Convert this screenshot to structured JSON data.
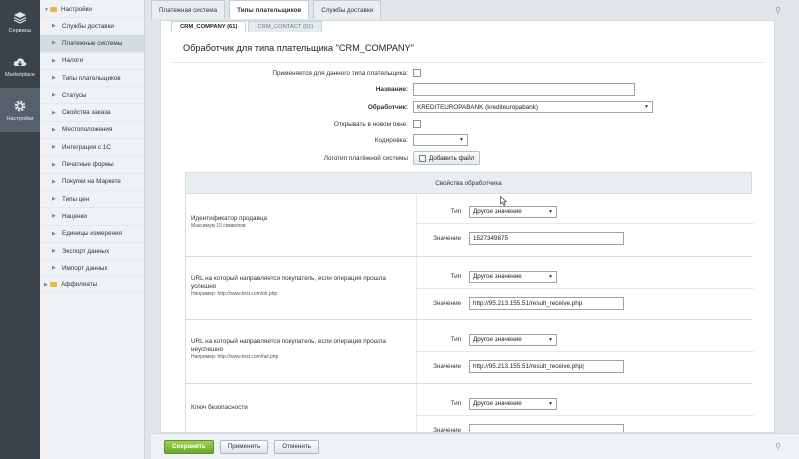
{
  "rail": [
    {
      "label": "Сервисы",
      "icon": "layers-icon"
    },
    {
      "label": "Marketplace",
      "icon": "cloud-download-icon"
    },
    {
      "label": "Настройки",
      "icon": "gear-icon"
    }
  ],
  "tree": {
    "root": "Настройки",
    "items": [
      "Службы доставки",
      "Платежные системы",
      "Налоги",
      "Типы плательщиков",
      "Статусы",
      "Свойства заказа",
      "Местоположения",
      "Интеграция с 1С",
      "Печатные формы",
      "Покупки на Маркете",
      "Типы цен",
      "Наценки",
      "Единицы измерения",
      "Экспорт данных",
      "Импорт данных"
    ],
    "selected_index": 1,
    "root2": "Аффилиаты"
  },
  "tabs": [
    "Платежная система",
    "Типы плательщиков",
    "Службы доставки"
  ],
  "subtabs": [
    "CRM_COMPANY (61)",
    "CRM_CONTACT (61)"
  ],
  "heading": "Обработчик для типа плательщика \"CRM_COMPANY\"",
  "form": {
    "applies_label": "Применяется для данного типа плательщика:",
    "name_label": "Название:",
    "name_value": "",
    "handler_label": "Обработчик:",
    "handler_value": "KREDITEUROPABANK (krediteuropabank)",
    "new_window_label": "Открывать в новом окне:",
    "encoding_label": "Кодировка:",
    "encoding_value": "",
    "logo_label": "Логотип платёжной системы",
    "add_file": "Добавить файл"
  },
  "props": {
    "title": "Свойства обработчика",
    "type_label": "Тип",
    "value_label": "Значение",
    "items": [
      {
        "desc": "Идентификатор продавца",
        "hint": "Максимум 15 символов",
        "type": "Другое значение",
        "value": "1527349875"
      },
      {
        "desc": "URL на который направляется покупатель, если операция прошла успешно",
        "hint": "Например: http://www.test.com/ok.php",
        "type": "Другое значение",
        "value": "http://95.213.155.51/result_receive.php"
      },
      {
        "desc": "URL на который направляется покупатель, если операция прошла неуспешно",
        "hint": "Например: http://www.test.com/fail.php",
        "type": "Другое значение",
        "value": "http://95.213.155.51/result_receive.php|"
      },
      {
        "desc": "Ключ безопасности",
        "hint": "",
        "type": "Другое значение",
        "value": ""
      }
    ]
  },
  "buttons": {
    "save": "Сохранить",
    "apply": "Применить",
    "cancel": "Отменить"
  },
  "colors": {
    "accent_green": "#6aa82c",
    "rail": "#3a434a"
  }
}
